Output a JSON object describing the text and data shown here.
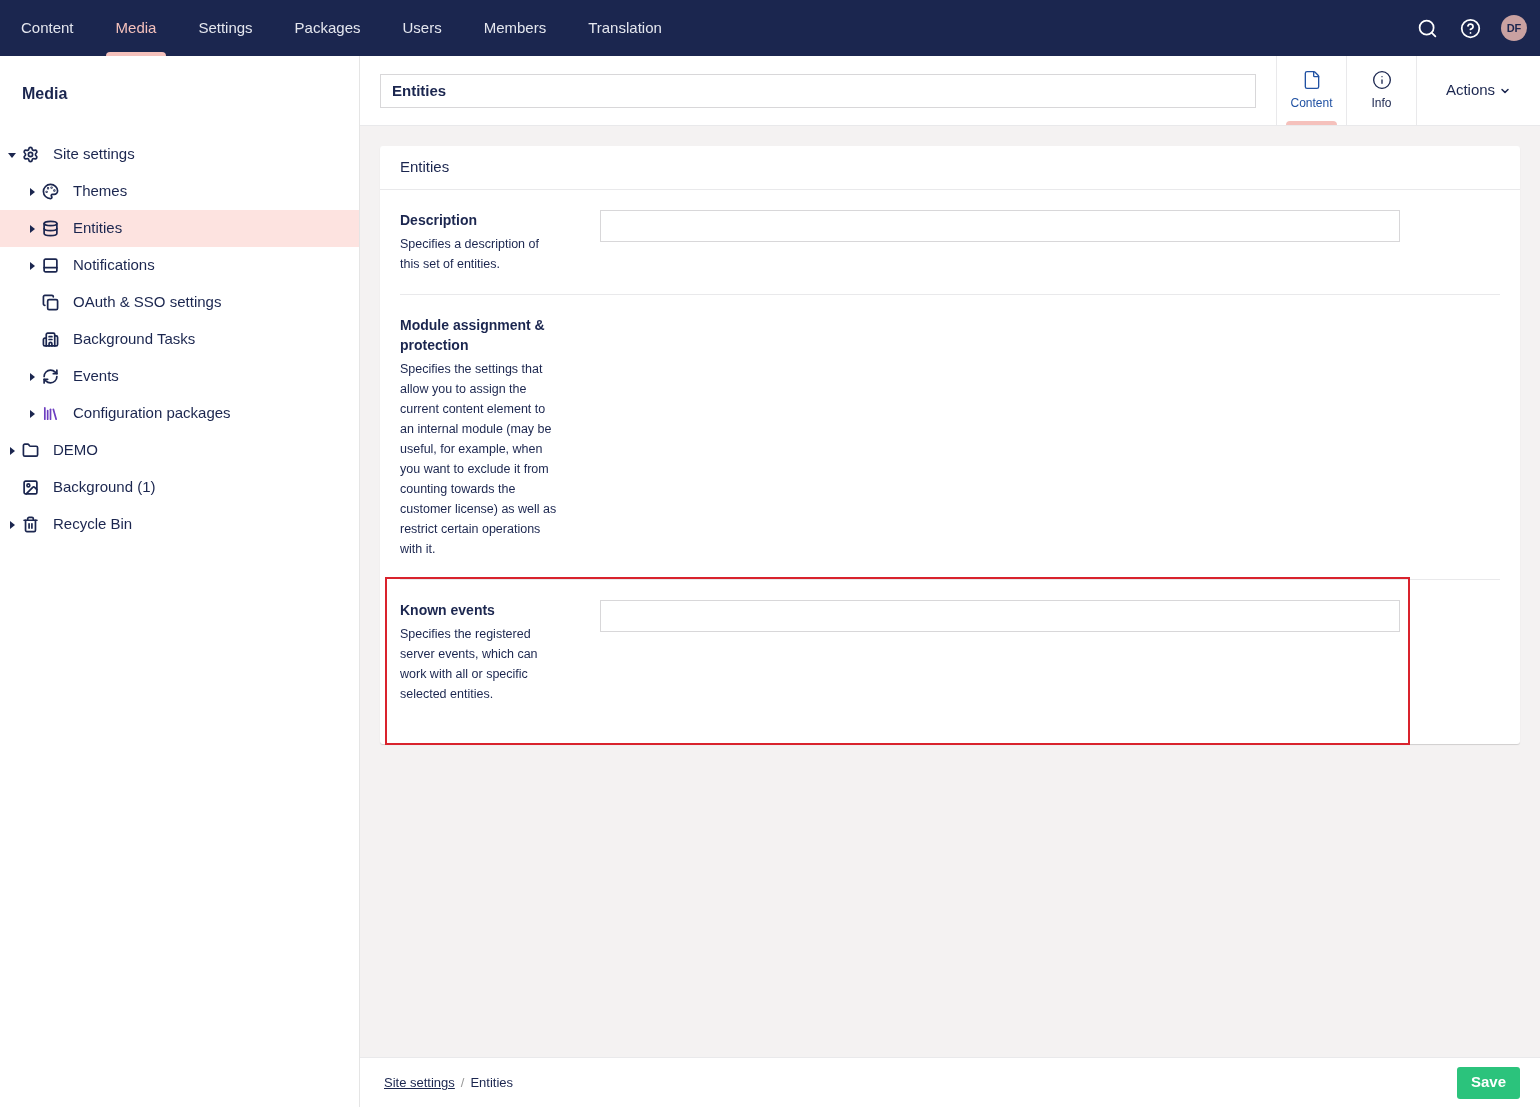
{
  "top_nav": {
    "sections": [
      {
        "label": "Content",
        "selected": false
      },
      {
        "label": "Media",
        "selected": true
      },
      {
        "label": "Settings",
        "selected": false
      },
      {
        "label": "Packages",
        "selected": false
      },
      {
        "label": "Users",
        "selected": false
      },
      {
        "label": "Members",
        "selected": false
      },
      {
        "label": "Translation",
        "selected": false
      }
    ],
    "avatar": "DF"
  },
  "sidebar": {
    "title": "Media",
    "tree": [
      {
        "label": "Site settings",
        "expanded": true,
        "selected": false,
        "children": [
          {
            "label": "Themes",
            "expanded": false,
            "selected": false
          },
          {
            "label": "Entities",
            "expanded": false,
            "selected": true
          },
          {
            "label": "Notifications",
            "expanded": false,
            "selected": false
          },
          {
            "label": "OAuth & SSO settings",
            "selected": false
          },
          {
            "label": "Background Tasks",
            "selected": false
          },
          {
            "label": "Events",
            "expanded": false,
            "selected": false
          },
          {
            "label": "Configuration packages",
            "expanded": false,
            "selected": false
          }
        ]
      },
      {
        "label": "DEMO",
        "expanded": false,
        "selected": false
      },
      {
        "label": "Background (1)",
        "selected": false
      },
      {
        "label": "Recycle Bin",
        "expanded": false,
        "selected": false
      }
    ]
  },
  "editor": {
    "name": "Entities",
    "views": [
      {
        "label": "Content",
        "selected": true
      },
      {
        "label": "Info",
        "selected": false
      }
    ],
    "actions": "Actions",
    "panel": {
      "title": "Entities",
      "properties": [
        {
          "kind": "input",
          "label": "Description",
          "description": "Specifies a description of this set of entities.",
          "highlighted": false
        },
        {
          "kind": "group",
          "label": "Module assignment & protection",
          "description": "Specifies the settings that allow you to assign the current content element to an internal module (may be useful, for example, when you want to exclude it from counting towards the customer license) as well as restrict certain operations with it.",
          "highlighted": false
        },
        {
          "kind": "input",
          "label": "Known events",
          "description": "Specifies the registered server events, which can work with all or specific selected entities.",
          "highlighted": true
        }
      ]
    }
  },
  "footer": {
    "breadcrumb": [
      "Site settings",
      "Entities"
    ],
    "separator": "/",
    "save": "Save"
  }
}
